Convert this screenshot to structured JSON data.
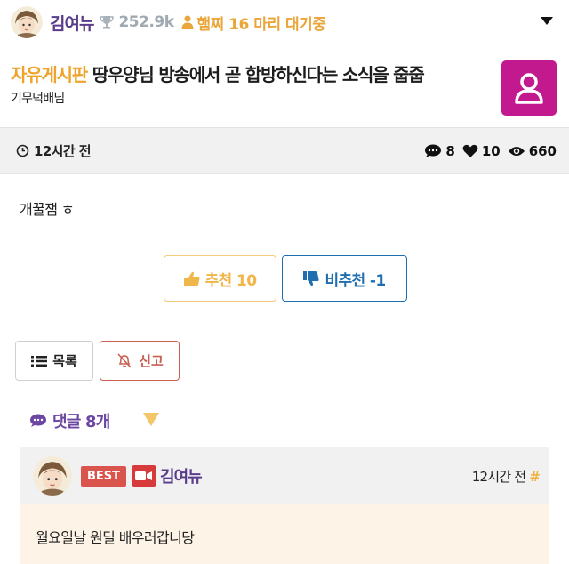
{
  "topbar": {
    "nickname": "김여뉴",
    "trophy_score": "252.9k",
    "follower_text": "햄찌 16 마리 대기중"
  },
  "post": {
    "board": "자유게시판",
    "title": "땅우양님 방송에서 곧 합방하신다는 소식을 줍줍",
    "author": "기무덕배님",
    "time": "12시간 전",
    "comments_count": "8",
    "likes_count": "10",
    "views_count": "660",
    "body": "개꿀잼 ㅎ"
  },
  "votes": {
    "up_label": "추천 10",
    "down_label": "비추천 -1"
  },
  "actions": {
    "list_label": "목록",
    "report_label": "신고"
  },
  "comments": {
    "header": "댓글 8개",
    "items": [
      {
        "badge": "BEST",
        "nickname": "김여뉴",
        "time": "12시간 전",
        "hash": "#",
        "text": "월요일날 원딜 배우러갑니당"
      }
    ]
  },
  "colors": {
    "accent_purple": "#5a3c8c",
    "board_gold": "#f0a32a",
    "user_box": "#c2198e",
    "downvote_blue": "#1f6fb0",
    "report_red": "#c85f51"
  }
}
